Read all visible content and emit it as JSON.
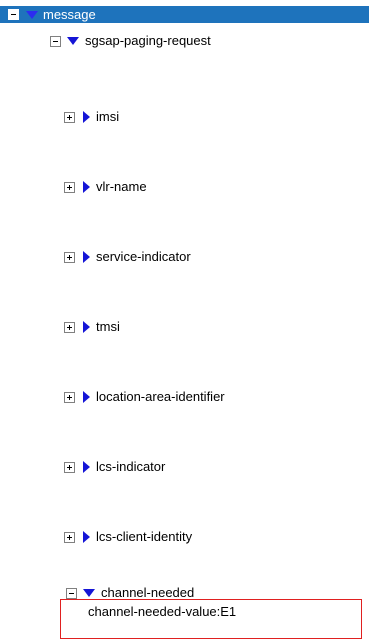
{
  "tree": {
    "root": {
      "label": "message",
      "expanded": true,
      "children": {
        "request": {
          "label": "sgsap-paging-request",
          "expanded": true,
          "items": [
            {
              "label": "imsi",
              "expanded": false
            },
            {
              "label": "vlr-name",
              "expanded": false
            },
            {
              "label": "service-indicator",
              "expanded": false
            },
            {
              "label": "tmsi",
              "expanded": false
            },
            {
              "label": "location-area-identifier",
              "expanded": false
            },
            {
              "label": "lcs-indicator",
              "expanded": false
            },
            {
              "label": "lcs-client-identity",
              "expanded": false
            }
          ],
          "highlighted_item": {
            "label": "channel-needed",
            "expanded": true,
            "value": "channel-needed-value:E1"
          }
        }
      }
    }
  },
  "colors": {
    "selection_bar": "#1e73bc",
    "triangle": "#1515d6",
    "highlight_border": "#e02020"
  }
}
